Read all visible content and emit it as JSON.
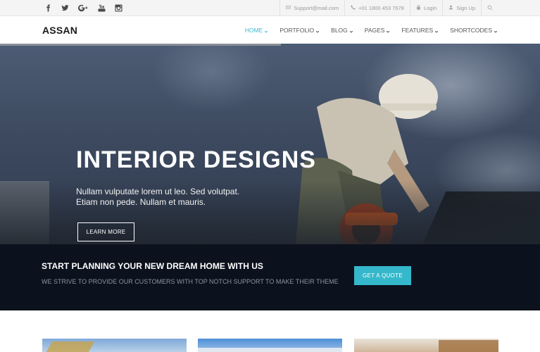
{
  "topbar": {
    "social": [
      "facebook-icon",
      "twitter-icon",
      "google-plus-icon",
      "youtube-icon",
      "instagram-icon"
    ],
    "email": "Support@mail.com",
    "phone": "+01 1800 453 7678",
    "login": "Login",
    "signup": "Sign Up"
  },
  "nav": {
    "logo": "ASSAN",
    "items": [
      {
        "label": "HOME"
      },
      {
        "label": "PORTFOLIO"
      },
      {
        "label": "BLOG"
      },
      {
        "label": "PAGES"
      },
      {
        "label": "FEATURES"
      },
      {
        "label": "SHORTCODES"
      }
    ]
  },
  "hero": {
    "title": "INTERIOR DESIGNS",
    "subtitle_line1": "Nullam vulputate lorem ut leo. Sed volutpat.",
    "subtitle_line2": "Etiam non pede. Nullam et mauris.",
    "button": "LEARN MORE"
  },
  "cta": {
    "title": "START PLANNING YOUR NEW DREAM HOME WITH US",
    "subtitle": "WE STRIVE TO PROVIDE OUR CUSTOMERS WITH TOP NOTCH SUPPORT TO MAKE THEIR THEME",
    "button": "GET A QUOTE"
  },
  "colors": {
    "accent": "#35b8cb",
    "nav_active": "#3fb7d1",
    "cta_bg": "#0b121d"
  }
}
